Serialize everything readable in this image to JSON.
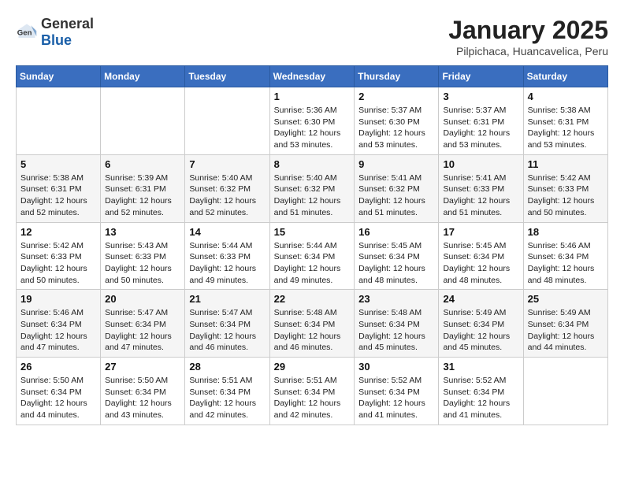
{
  "logo": {
    "general": "General",
    "blue": "Blue"
  },
  "title": "January 2025",
  "subtitle": "Pilpichaca, Huancavelica, Peru",
  "weekdays": [
    "Sunday",
    "Monday",
    "Tuesday",
    "Wednesday",
    "Thursday",
    "Friday",
    "Saturday"
  ],
  "weeks": [
    [
      {
        "day": "",
        "info": ""
      },
      {
        "day": "",
        "info": ""
      },
      {
        "day": "",
        "info": ""
      },
      {
        "day": "1",
        "info": "Sunrise: 5:36 AM\nSunset: 6:30 PM\nDaylight: 12 hours\nand 53 minutes."
      },
      {
        "day": "2",
        "info": "Sunrise: 5:37 AM\nSunset: 6:30 PM\nDaylight: 12 hours\nand 53 minutes."
      },
      {
        "day": "3",
        "info": "Sunrise: 5:37 AM\nSunset: 6:31 PM\nDaylight: 12 hours\nand 53 minutes."
      },
      {
        "day": "4",
        "info": "Sunrise: 5:38 AM\nSunset: 6:31 PM\nDaylight: 12 hours\nand 53 minutes."
      }
    ],
    [
      {
        "day": "5",
        "info": "Sunrise: 5:38 AM\nSunset: 6:31 PM\nDaylight: 12 hours\nand 52 minutes."
      },
      {
        "day": "6",
        "info": "Sunrise: 5:39 AM\nSunset: 6:31 PM\nDaylight: 12 hours\nand 52 minutes."
      },
      {
        "day": "7",
        "info": "Sunrise: 5:40 AM\nSunset: 6:32 PM\nDaylight: 12 hours\nand 52 minutes."
      },
      {
        "day": "8",
        "info": "Sunrise: 5:40 AM\nSunset: 6:32 PM\nDaylight: 12 hours\nand 51 minutes."
      },
      {
        "day": "9",
        "info": "Sunrise: 5:41 AM\nSunset: 6:32 PM\nDaylight: 12 hours\nand 51 minutes."
      },
      {
        "day": "10",
        "info": "Sunrise: 5:41 AM\nSunset: 6:33 PM\nDaylight: 12 hours\nand 51 minutes."
      },
      {
        "day": "11",
        "info": "Sunrise: 5:42 AM\nSunset: 6:33 PM\nDaylight: 12 hours\nand 50 minutes."
      }
    ],
    [
      {
        "day": "12",
        "info": "Sunrise: 5:42 AM\nSunset: 6:33 PM\nDaylight: 12 hours\nand 50 minutes."
      },
      {
        "day": "13",
        "info": "Sunrise: 5:43 AM\nSunset: 6:33 PM\nDaylight: 12 hours\nand 50 minutes."
      },
      {
        "day": "14",
        "info": "Sunrise: 5:44 AM\nSunset: 6:33 PM\nDaylight: 12 hours\nand 49 minutes."
      },
      {
        "day": "15",
        "info": "Sunrise: 5:44 AM\nSunset: 6:34 PM\nDaylight: 12 hours\nand 49 minutes."
      },
      {
        "day": "16",
        "info": "Sunrise: 5:45 AM\nSunset: 6:34 PM\nDaylight: 12 hours\nand 48 minutes."
      },
      {
        "day": "17",
        "info": "Sunrise: 5:45 AM\nSunset: 6:34 PM\nDaylight: 12 hours\nand 48 minutes."
      },
      {
        "day": "18",
        "info": "Sunrise: 5:46 AM\nSunset: 6:34 PM\nDaylight: 12 hours\nand 48 minutes."
      }
    ],
    [
      {
        "day": "19",
        "info": "Sunrise: 5:46 AM\nSunset: 6:34 PM\nDaylight: 12 hours\nand 47 minutes."
      },
      {
        "day": "20",
        "info": "Sunrise: 5:47 AM\nSunset: 6:34 PM\nDaylight: 12 hours\nand 47 minutes."
      },
      {
        "day": "21",
        "info": "Sunrise: 5:47 AM\nSunset: 6:34 PM\nDaylight: 12 hours\nand 46 minutes."
      },
      {
        "day": "22",
        "info": "Sunrise: 5:48 AM\nSunset: 6:34 PM\nDaylight: 12 hours\nand 46 minutes."
      },
      {
        "day": "23",
        "info": "Sunrise: 5:48 AM\nSunset: 6:34 PM\nDaylight: 12 hours\nand 45 minutes."
      },
      {
        "day": "24",
        "info": "Sunrise: 5:49 AM\nSunset: 6:34 PM\nDaylight: 12 hours\nand 45 minutes."
      },
      {
        "day": "25",
        "info": "Sunrise: 5:49 AM\nSunset: 6:34 PM\nDaylight: 12 hours\nand 44 minutes."
      }
    ],
    [
      {
        "day": "26",
        "info": "Sunrise: 5:50 AM\nSunset: 6:34 PM\nDaylight: 12 hours\nand 44 minutes."
      },
      {
        "day": "27",
        "info": "Sunrise: 5:50 AM\nSunset: 6:34 PM\nDaylight: 12 hours\nand 43 minutes."
      },
      {
        "day": "28",
        "info": "Sunrise: 5:51 AM\nSunset: 6:34 PM\nDaylight: 12 hours\nand 42 minutes."
      },
      {
        "day": "29",
        "info": "Sunrise: 5:51 AM\nSunset: 6:34 PM\nDaylight: 12 hours\nand 42 minutes."
      },
      {
        "day": "30",
        "info": "Sunrise: 5:52 AM\nSunset: 6:34 PM\nDaylight: 12 hours\nand 41 minutes."
      },
      {
        "day": "31",
        "info": "Sunrise: 5:52 AM\nSunset: 6:34 PM\nDaylight: 12 hours\nand 41 minutes."
      },
      {
        "day": "",
        "info": ""
      }
    ]
  ]
}
